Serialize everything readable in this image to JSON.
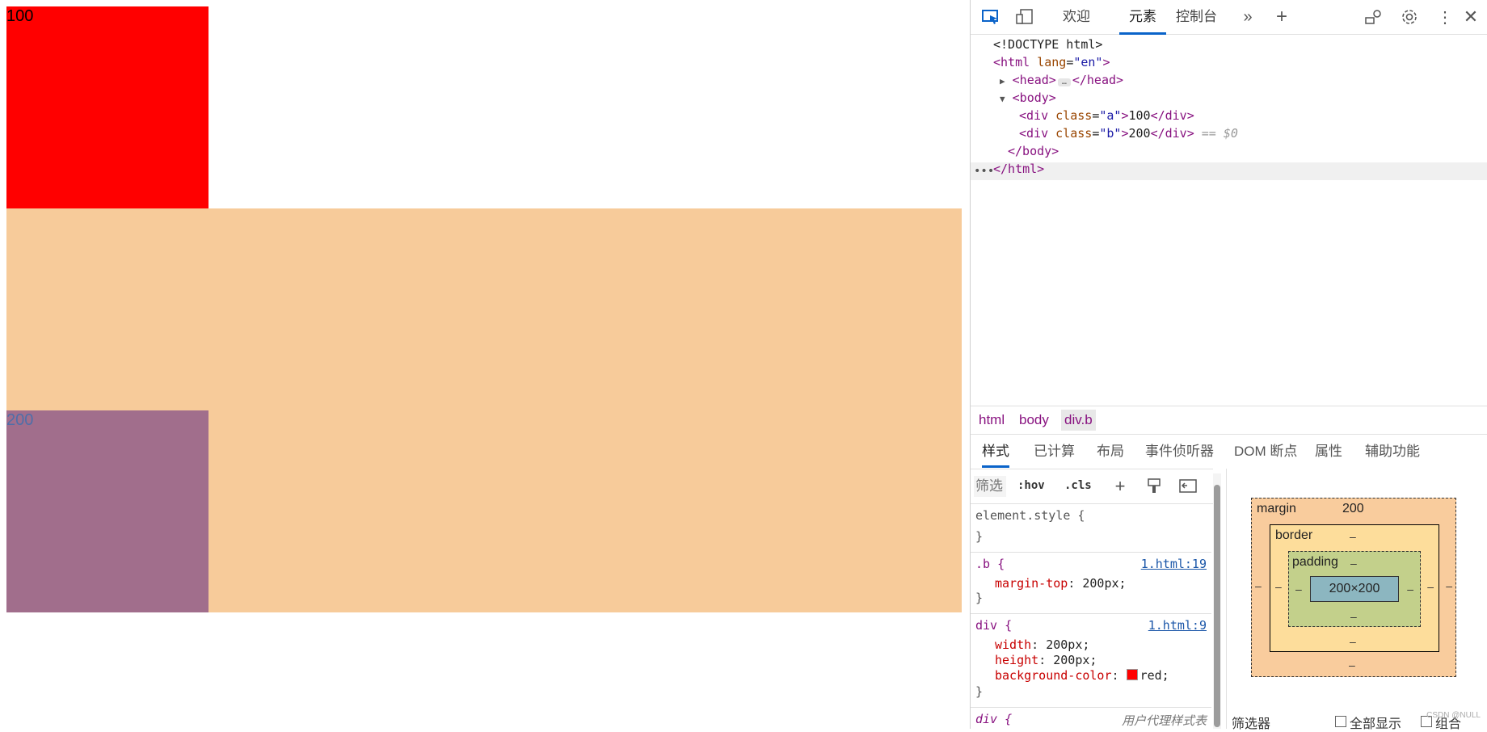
{
  "page": {
    "box_a_text": "100",
    "box_b_text": "200"
  },
  "toolbar": {
    "tabs": [
      "欢迎",
      "元素",
      "控制台"
    ],
    "active_tab": "元素",
    "icons": [
      "inspect-icon",
      "device-toolbar-icon",
      "more-tabs-icon",
      "add-tab-icon",
      "customize-icon",
      "settings-icon",
      "kebab-menu-icon",
      "close-icon"
    ]
  },
  "dom": {
    "doctype": "<!DOCTYPE html>",
    "html_open_tag": "<html",
    "html_attr": "lang",
    "html_attr_val": "\"en\"",
    "head": "<head>",
    "head_close": "</head>",
    "body": "<body>",
    "div_open": "<div",
    "class_attr": "class",
    "div_a_class": "\"a\"",
    "div_a_text": "100",
    "div_b_class": "\"b\"",
    "div_b_text": "200",
    "div_close": "</div>",
    "eq_marker": "== $0",
    "body_close": "</body>",
    "html_close": "</html>"
  },
  "breadcrumb": [
    "html",
    "body",
    "div.b"
  ],
  "subtabs": [
    "样式",
    "已计算",
    "布局",
    "事件侦听器",
    "DOM 断点",
    "属性",
    "辅助功能"
  ],
  "styles": {
    "filter_placeholder": "筛选",
    "hov": ":hov",
    "cls": ".cls",
    "element_style": "element.style {",
    "close_brace": "}",
    "rule_b": {
      "selector": ".b {",
      "source": "1.html:19",
      "prop": "margin-top",
      "value": "200px;"
    },
    "rule_div": {
      "selector": "div {",
      "source": "1.html:9",
      "props": [
        {
          "prop": "width",
          "value": "200px;"
        },
        {
          "prop": "height",
          "value": "200px;"
        },
        {
          "prop": "background-color",
          "value": "red;"
        }
      ]
    },
    "ua_selector": "div {",
    "ua_source": "用户代理样式表"
  },
  "box_model": {
    "margin_label": "margin",
    "margin_top": "200",
    "border_label": "border",
    "padding_label": "padding",
    "content": "200×200",
    "dash": "–"
  },
  "box_model_footer": {
    "filter": "筛选器",
    "show_all": "全部显示",
    "group": "组合",
    "watermark": "CSDN @NULL"
  },
  "colors": {
    "box_a": "#ff0000",
    "margin_overlay": "#f7cb9a",
    "box_b": "#a16e8c",
    "accent": "#0a63c9"
  }
}
